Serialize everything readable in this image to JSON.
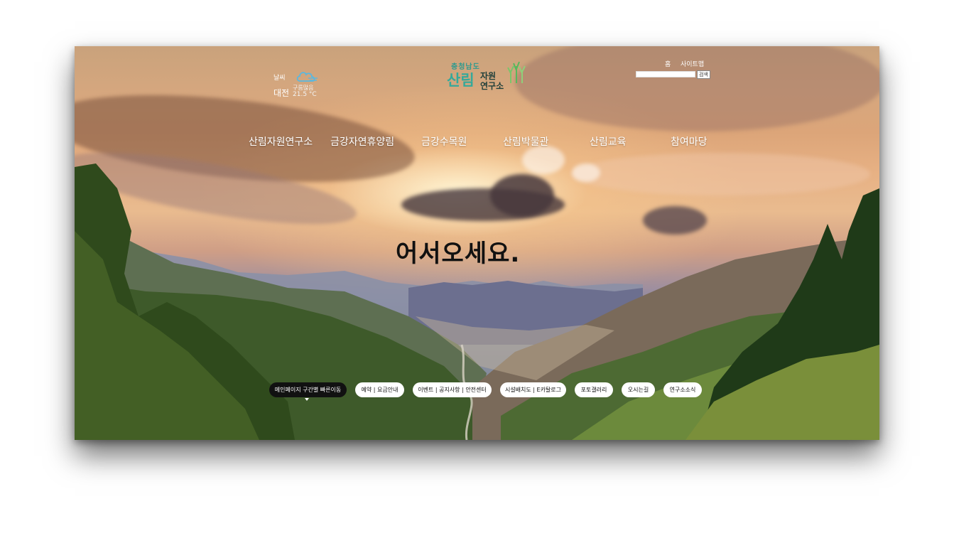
{
  "colors": {
    "logo_teal": "#35a99a",
    "logo_dark": "#1f3f3a",
    "quick_active_bg": "#111111",
    "quick_bg": "#ffffff"
  },
  "weather": {
    "label": "날씨",
    "city": "대전",
    "condition": "구름많음",
    "temperature": "21.5 °C",
    "icon": "cloud-icon"
  },
  "logo": {
    "province": "충청남도",
    "name_big": "산림",
    "name_line1": "자원",
    "name_line2": "연구소",
    "icon": "tree-icon"
  },
  "util": {
    "home": "홈",
    "sitemap": "사이트맵",
    "search_placeholder": "",
    "search_button": "검색"
  },
  "nav": {
    "items": [
      "산림자원연구소",
      "금강자연휴양림",
      "금강수목원",
      "산림박물관",
      "산림교육",
      "참여마당"
    ]
  },
  "hero": {
    "welcome": "어서오세요."
  },
  "quick_links": [
    {
      "label": "메인페이지 구간별 빠른이동",
      "active": true
    },
    {
      "label": "예약 | 요금안내",
      "active": false
    },
    {
      "label": "이벤트 | 공지사항 | 안전센터",
      "active": false
    },
    {
      "label": "시설배치도 | E카탈로그",
      "active": false
    },
    {
      "label": "포토갤러리",
      "active": false
    },
    {
      "label": "오시는길",
      "active": false
    },
    {
      "label": "연구소소식",
      "active": false
    }
  ]
}
